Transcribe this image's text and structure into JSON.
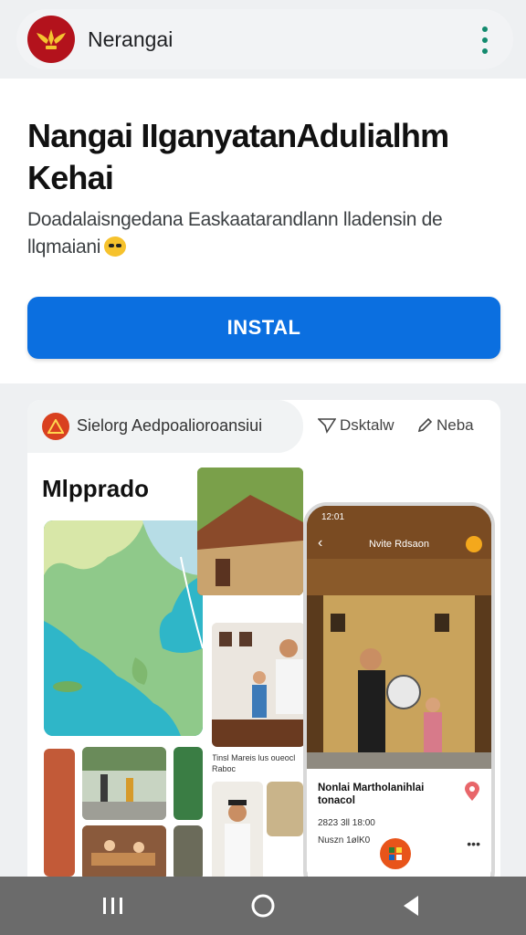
{
  "app": {
    "name": "Nerangai"
  },
  "hero": {
    "title": "Nangai IIganyatanAdulialhm Kehai",
    "description": "Doadalaisngedana Easkaatarandlann lladensin de llqmaiani",
    "install_label": "INSTAL"
  },
  "screenshot": {
    "tab_label": "Sielorg Aedpoalioroansiui",
    "action_1": "Dsktalw",
    "action_2": "Neba",
    "heading": "Mlpprado",
    "photo_caption": "Tinsl Mareis lus oueocl Raboc",
    "phone": {
      "status_time": "12:01",
      "header_title": "Nvite Rdsaon",
      "info_title": "Nonlai Martholanihlai tonacol",
      "info_meta": "2823 3ll 18:00",
      "info_meta2": "Nuszn 1ølK0",
      "more": "•••"
    }
  },
  "colors": {
    "accent": "#0b6fe0",
    "brand": "#b3121c",
    "menu": "#138a6e"
  },
  "icons": [
    "app-logo-icon",
    "more-vert-icon",
    "app-badge-icon",
    "send-icon",
    "edit-icon",
    "pin-icon",
    "grid-icon",
    "recents-icon",
    "home-icon",
    "back-icon"
  ]
}
